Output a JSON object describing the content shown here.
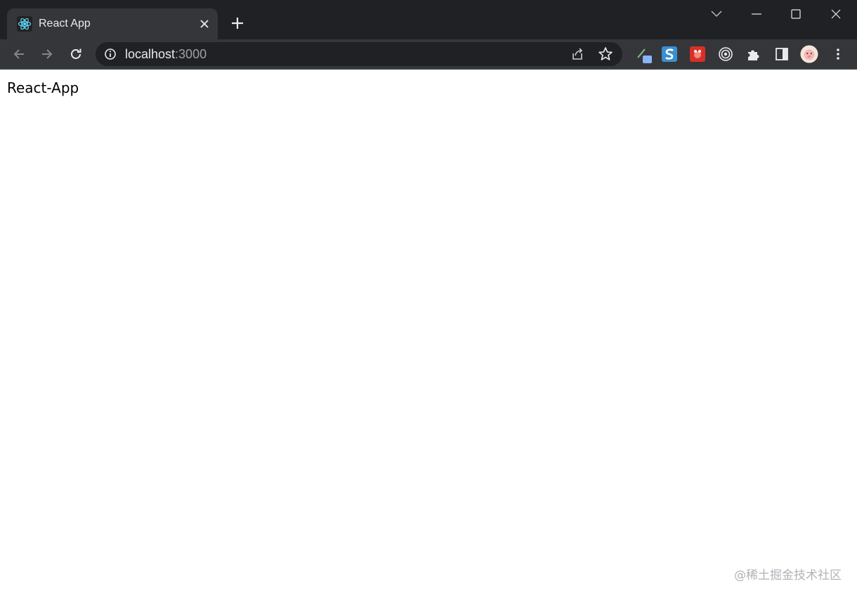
{
  "browser": {
    "tab": {
      "title": "React App",
      "favicon": "react-logo-icon"
    },
    "new_tab_label": "+",
    "address": {
      "host": "localhost",
      "port": ":3000"
    },
    "colors": {
      "frame": "#202124",
      "toolbar": "#35363a",
      "react_accent": "#61dafb"
    }
  },
  "page": {
    "heading": "React-App",
    "watermark": "@稀土掘金技术社区"
  }
}
